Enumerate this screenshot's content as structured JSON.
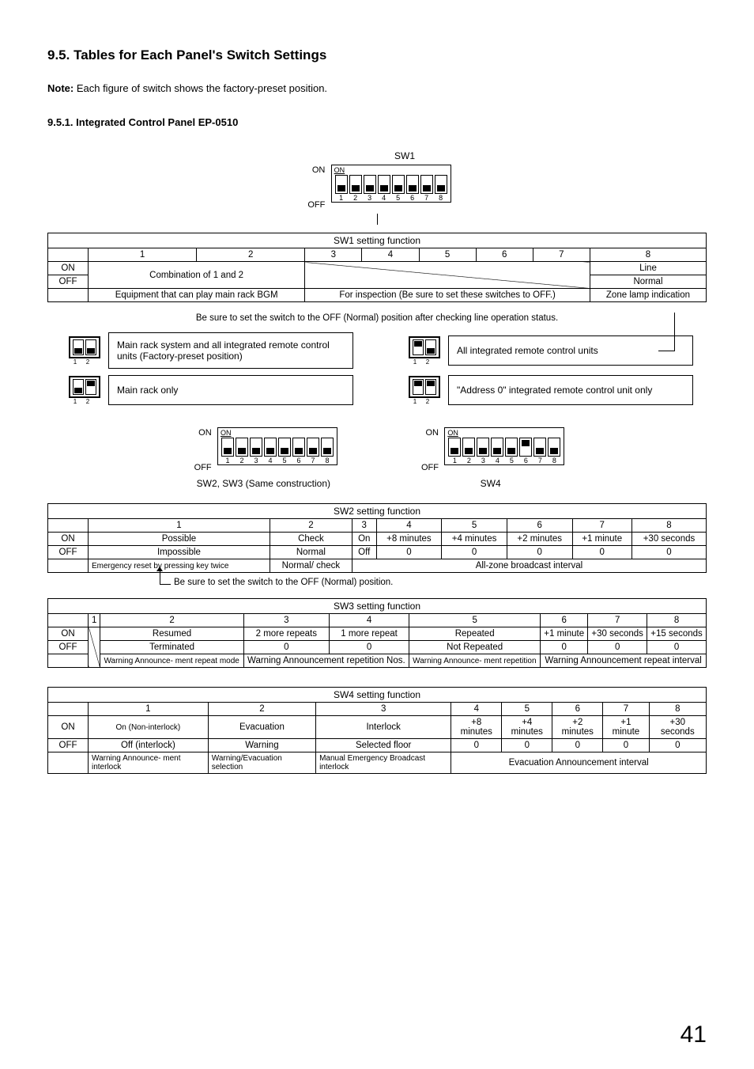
{
  "heading": "9.5. Tables for Each Panel's Switch Settings",
  "note_label": "Note:",
  "note_text": " Each figure of switch shows the factory-preset position.",
  "sub_heading": "9.5.1. Integrated Control Panel  EP-0510",
  "on": "ON",
  "off": "OFF",
  "sw_on_inner": "ON",
  "page_number": "41",
  "sw1": {
    "fig_title": "SW1",
    "positions": [
      "down",
      "down",
      "down",
      "down",
      "down",
      "down",
      "down",
      "down"
    ],
    "table_title": "SW1 setting function",
    "cols": [
      "1",
      "2",
      "3",
      "4",
      "5",
      "6",
      "7",
      "8"
    ],
    "row_on_12": "Combination of 1 and 2",
    "row_on_8": "Line",
    "row_off_8": "Normal",
    "equip": "Equipment that can play main rack BGM",
    "inspection": "For inspection (Be sure to set these switches to OFF.)",
    "zone": "Zone lamp indication",
    "note_line": "Be sure to set the switch to the OFF (Normal) position after checking line operation status.",
    "r1_left": "Main rack system and all integrated remote control units (Factory-preset position)",
    "r1_right": "All integrated remote control units",
    "r2_left": "Main rack only",
    "r2_right": "\"Address 0\" integrated remote control unit only",
    "mini_left_a": [
      "down",
      "down"
    ],
    "mini_left_b": [
      "down",
      "up"
    ],
    "mini_right_a": [
      "up",
      "down"
    ],
    "mini_right_b": [
      "up",
      "up"
    ]
  },
  "sw23_caption": "SW2, SW3 (Same construction)",
  "sw23_positions": [
    "down",
    "down",
    "down",
    "down",
    "down",
    "down",
    "down",
    "down"
  ],
  "sw4_caption": "SW4",
  "sw4_positions": [
    "down",
    "down",
    "down",
    "down",
    "down",
    "up",
    "down",
    "down"
  ],
  "sw2": {
    "title": "SW2 setting function",
    "cols": [
      "1",
      "2",
      "3",
      "4",
      "5",
      "6",
      "7",
      "8"
    ],
    "on": [
      "Possible",
      "Check",
      "On",
      "+8 minutes",
      "+4 minutes",
      "+2 minutes",
      "+1 minute",
      "+30 seconds"
    ],
    "off": [
      "Impossible",
      "Normal",
      "Off",
      "0",
      "0",
      "0",
      "0",
      "0"
    ],
    "desc1": "Emergency reset by pressing key twice",
    "desc2": "Normal/ check",
    "desc_span": "All-zone broadcast interval",
    "foot": "Be sure to set the switch to the OFF (Normal) position."
  },
  "sw3": {
    "title": "SW3 setting function",
    "cols": [
      "1",
      "2",
      "3",
      "4",
      "5",
      "6",
      "7",
      "8"
    ],
    "on": [
      "",
      "Resumed",
      "2 more repeats",
      "1 more repeat",
      "Repeated",
      "+1 minute",
      "+30 seconds",
      "+15 seconds"
    ],
    "off": [
      "",
      "Terminated",
      "0",
      "0",
      "Not Repeated",
      "0",
      "0",
      "0"
    ],
    "desc2": "Warning Announce- ment repeat mode",
    "desc34": "Warning Announcement repetition Nos.",
    "desc5": "Warning Announce- ment repetition",
    "desc678": "Warning Announcement repeat interval"
  },
  "sw4": {
    "title": "SW4 setting function",
    "cols": [
      "1",
      "2",
      "3",
      "4",
      "5",
      "6",
      "7",
      "8"
    ],
    "on": [
      "On (Non-interlock)",
      "Evacuation",
      "Interlock",
      "+8 minutes",
      "+4 minutes",
      "+2 minutes",
      "+1 minute",
      "+30 seconds"
    ],
    "off": [
      "Off (interlock)",
      "Warning",
      "Selected floor",
      "0",
      "0",
      "0",
      "0",
      "0"
    ],
    "desc1": "Warning Announce- ment interlock",
    "desc2": "Warning/Evacuation selection",
    "desc3": "Manual Emergency Broadcast interlock",
    "desc_span": "Evacuation Announcement interval"
  }
}
